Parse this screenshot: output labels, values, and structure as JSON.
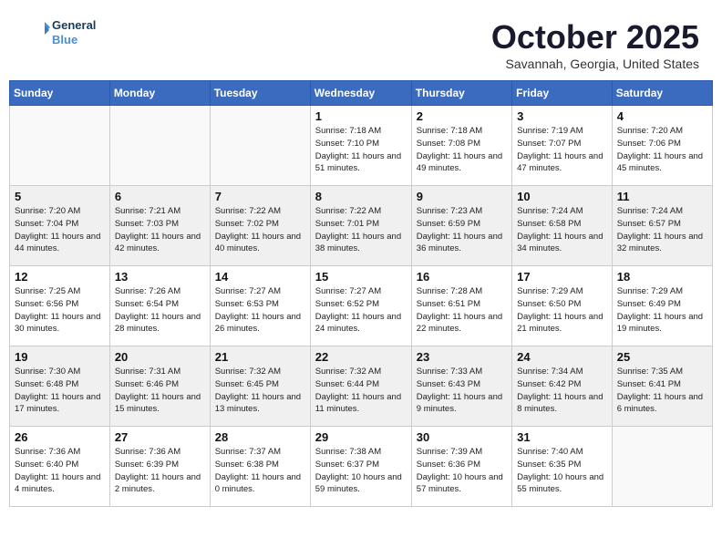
{
  "header": {
    "logo_line1": "General",
    "logo_line2": "Blue",
    "month": "October 2025",
    "location": "Savannah, Georgia, United States"
  },
  "weekdays": [
    "Sunday",
    "Monday",
    "Tuesday",
    "Wednesday",
    "Thursday",
    "Friday",
    "Saturday"
  ],
  "weeks": [
    [
      {
        "day": "",
        "info": ""
      },
      {
        "day": "",
        "info": ""
      },
      {
        "day": "",
        "info": ""
      },
      {
        "day": "1",
        "info": "Sunrise: 7:18 AM\nSunset: 7:10 PM\nDaylight: 11 hours\nand 51 minutes."
      },
      {
        "day": "2",
        "info": "Sunrise: 7:18 AM\nSunset: 7:08 PM\nDaylight: 11 hours\nand 49 minutes."
      },
      {
        "day": "3",
        "info": "Sunrise: 7:19 AM\nSunset: 7:07 PM\nDaylight: 11 hours\nand 47 minutes."
      },
      {
        "day": "4",
        "info": "Sunrise: 7:20 AM\nSunset: 7:06 PM\nDaylight: 11 hours\nand 45 minutes."
      }
    ],
    [
      {
        "day": "5",
        "info": "Sunrise: 7:20 AM\nSunset: 7:04 PM\nDaylight: 11 hours\nand 44 minutes."
      },
      {
        "day": "6",
        "info": "Sunrise: 7:21 AM\nSunset: 7:03 PM\nDaylight: 11 hours\nand 42 minutes."
      },
      {
        "day": "7",
        "info": "Sunrise: 7:22 AM\nSunset: 7:02 PM\nDaylight: 11 hours\nand 40 minutes."
      },
      {
        "day": "8",
        "info": "Sunrise: 7:22 AM\nSunset: 7:01 PM\nDaylight: 11 hours\nand 38 minutes."
      },
      {
        "day": "9",
        "info": "Sunrise: 7:23 AM\nSunset: 6:59 PM\nDaylight: 11 hours\nand 36 minutes."
      },
      {
        "day": "10",
        "info": "Sunrise: 7:24 AM\nSunset: 6:58 PM\nDaylight: 11 hours\nand 34 minutes."
      },
      {
        "day": "11",
        "info": "Sunrise: 7:24 AM\nSunset: 6:57 PM\nDaylight: 11 hours\nand 32 minutes."
      }
    ],
    [
      {
        "day": "12",
        "info": "Sunrise: 7:25 AM\nSunset: 6:56 PM\nDaylight: 11 hours\nand 30 minutes."
      },
      {
        "day": "13",
        "info": "Sunrise: 7:26 AM\nSunset: 6:54 PM\nDaylight: 11 hours\nand 28 minutes."
      },
      {
        "day": "14",
        "info": "Sunrise: 7:27 AM\nSunset: 6:53 PM\nDaylight: 11 hours\nand 26 minutes."
      },
      {
        "day": "15",
        "info": "Sunrise: 7:27 AM\nSunset: 6:52 PM\nDaylight: 11 hours\nand 24 minutes."
      },
      {
        "day": "16",
        "info": "Sunrise: 7:28 AM\nSunset: 6:51 PM\nDaylight: 11 hours\nand 22 minutes."
      },
      {
        "day": "17",
        "info": "Sunrise: 7:29 AM\nSunset: 6:50 PM\nDaylight: 11 hours\nand 21 minutes."
      },
      {
        "day": "18",
        "info": "Sunrise: 7:29 AM\nSunset: 6:49 PM\nDaylight: 11 hours\nand 19 minutes."
      }
    ],
    [
      {
        "day": "19",
        "info": "Sunrise: 7:30 AM\nSunset: 6:48 PM\nDaylight: 11 hours\nand 17 minutes."
      },
      {
        "day": "20",
        "info": "Sunrise: 7:31 AM\nSunset: 6:46 PM\nDaylight: 11 hours\nand 15 minutes."
      },
      {
        "day": "21",
        "info": "Sunrise: 7:32 AM\nSunset: 6:45 PM\nDaylight: 11 hours\nand 13 minutes."
      },
      {
        "day": "22",
        "info": "Sunrise: 7:32 AM\nSunset: 6:44 PM\nDaylight: 11 hours\nand 11 minutes."
      },
      {
        "day": "23",
        "info": "Sunrise: 7:33 AM\nSunset: 6:43 PM\nDaylight: 11 hours\nand 9 minutes."
      },
      {
        "day": "24",
        "info": "Sunrise: 7:34 AM\nSunset: 6:42 PM\nDaylight: 11 hours\nand 8 minutes."
      },
      {
        "day": "25",
        "info": "Sunrise: 7:35 AM\nSunset: 6:41 PM\nDaylight: 11 hours\nand 6 minutes."
      }
    ],
    [
      {
        "day": "26",
        "info": "Sunrise: 7:36 AM\nSunset: 6:40 PM\nDaylight: 11 hours\nand 4 minutes."
      },
      {
        "day": "27",
        "info": "Sunrise: 7:36 AM\nSunset: 6:39 PM\nDaylight: 11 hours\nand 2 minutes."
      },
      {
        "day": "28",
        "info": "Sunrise: 7:37 AM\nSunset: 6:38 PM\nDaylight: 11 hours\nand 0 minutes."
      },
      {
        "day": "29",
        "info": "Sunrise: 7:38 AM\nSunset: 6:37 PM\nDaylight: 10 hours\nand 59 minutes."
      },
      {
        "day": "30",
        "info": "Sunrise: 7:39 AM\nSunset: 6:36 PM\nDaylight: 10 hours\nand 57 minutes."
      },
      {
        "day": "31",
        "info": "Sunrise: 7:40 AM\nSunset: 6:35 PM\nDaylight: 10 hours\nand 55 minutes."
      },
      {
        "day": "",
        "info": ""
      }
    ]
  ]
}
